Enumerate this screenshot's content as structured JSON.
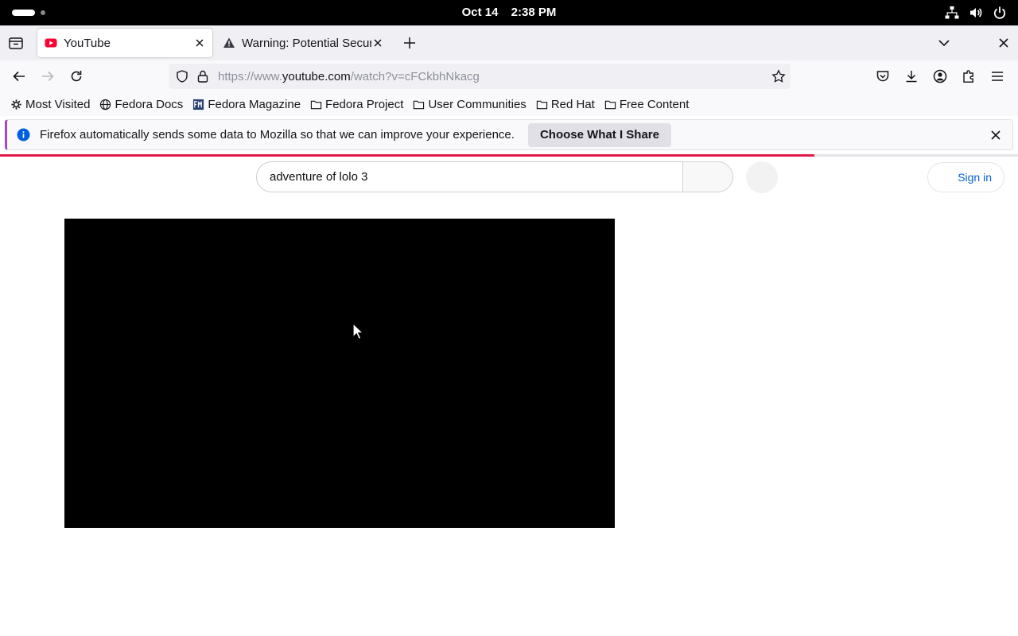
{
  "system_bar": {
    "date": "Oct 14",
    "time": "2:38 PM",
    "icons": [
      "network-icon",
      "volume-icon",
      "power-icon"
    ]
  },
  "tabs": [
    {
      "title": "YouTube",
      "active": true,
      "favicon": "youtube-icon"
    },
    {
      "title": "Warning: Potential Security Risk Ahead",
      "active": false,
      "favicon": "warning-icon"
    }
  ],
  "nav": {
    "url_prefix": "https://www.",
    "url_host": "youtube.com",
    "url_path": "/watch?v=cFCkbhNkacg"
  },
  "bookmarks": [
    {
      "label": "Most Visited",
      "icon": "gear-icon"
    },
    {
      "label": "Fedora Docs",
      "icon": "globe-icon"
    },
    {
      "label": "Fedora Magazine",
      "icon": "fedora-magazine-icon"
    },
    {
      "label": "Fedora Project",
      "icon": "folder-icon"
    },
    {
      "label": "User Communities",
      "icon": "folder-icon"
    },
    {
      "label": "Red Hat",
      "icon": "folder-icon"
    },
    {
      "label": "Free Content",
      "icon": "folder-icon"
    }
  ],
  "notification": {
    "message": "Firefox automatically sends some data to Mozilla so that we can improve your experience.",
    "button": "Choose What I Share"
  },
  "page_load_progress": 0.8,
  "youtube": {
    "search_value": "adventure of lolo 3",
    "sign_in": "Sign in"
  },
  "colors": {
    "accent_progress": "#e3194b",
    "notification_border": "#a646c9",
    "info_icon": "#0060df",
    "youtube_red": "#ff0033",
    "sign_in_text": "#065fd4"
  }
}
